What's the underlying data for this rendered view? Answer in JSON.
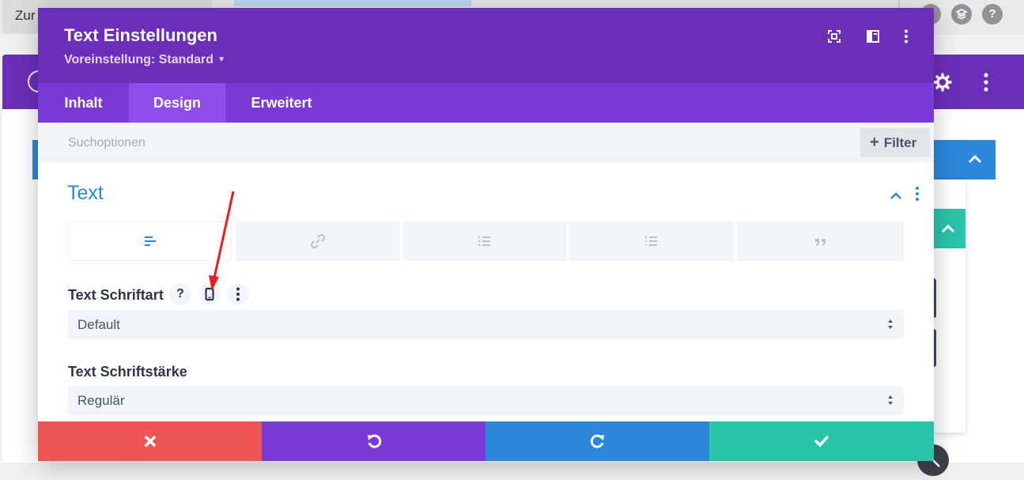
{
  "background": {
    "toolbar_button_label": "Zur",
    "help_glyph": "?",
    "accent_purple": "#6c2eb9",
    "accent_blue": "#2b87da",
    "accent_teal": "#29c4a9"
  },
  "modal": {
    "title": "Text Einstellungen",
    "preset": "Voreinstellung: Standard",
    "header_icons": [
      "fullscreen-icon",
      "split-view-icon",
      "more-options-icon"
    ],
    "tabs": [
      {
        "label": "Inhalt",
        "active": false
      },
      {
        "label": "Design",
        "active": true
      },
      {
        "label": "Erweitert",
        "active": false
      }
    ],
    "search": {
      "placeholder": "Suchoptionen",
      "value": ""
    },
    "filter_label": "Filter",
    "section": {
      "title": "Text",
      "subtabs": [
        {
          "icon": "align-left-icon",
          "active": true
        },
        {
          "icon": "link-icon",
          "active": false
        },
        {
          "icon": "unordered-list-icon",
          "active": false
        },
        {
          "icon": "ordered-list-icon",
          "active": false
        },
        {
          "icon": "quote-icon",
          "active": false
        }
      ],
      "fields": [
        {
          "label": "Text Schriftart",
          "value": "Default",
          "help_glyph": "?"
        },
        {
          "label": "Text Schriftstärke",
          "value": "Regulär"
        }
      ]
    },
    "footer": {
      "cancel_color": "#ef5555",
      "undo_color": "#7b3ad6",
      "redo_color": "#2b87da",
      "save_color": "#29c4a9"
    }
  }
}
